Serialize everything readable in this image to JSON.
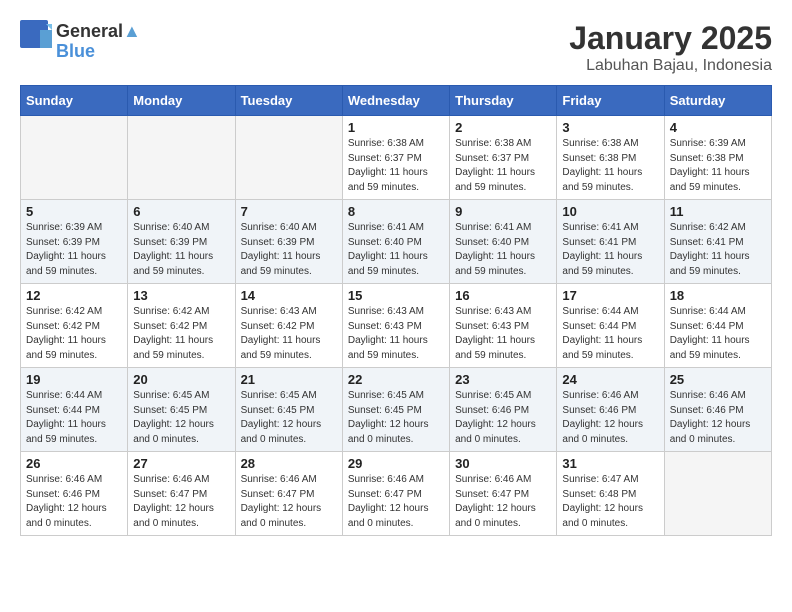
{
  "logo": {
    "general": "General",
    "blue": "Blue"
  },
  "title": "January 2025",
  "location": "Labuhan Bajau, Indonesia",
  "days_of_week": [
    "Sunday",
    "Monday",
    "Tuesday",
    "Wednesday",
    "Thursday",
    "Friday",
    "Saturday"
  ],
  "weeks": [
    [
      {
        "day": "",
        "info": ""
      },
      {
        "day": "",
        "info": ""
      },
      {
        "day": "",
        "info": ""
      },
      {
        "day": "1",
        "info": "Sunrise: 6:38 AM\nSunset: 6:37 PM\nDaylight: 11 hours\nand 59 minutes."
      },
      {
        "day": "2",
        "info": "Sunrise: 6:38 AM\nSunset: 6:37 PM\nDaylight: 11 hours\nand 59 minutes."
      },
      {
        "day": "3",
        "info": "Sunrise: 6:38 AM\nSunset: 6:38 PM\nDaylight: 11 hours\nand 59 minutes."
      },
      {
        "day": "4",
        "info": "Sunrise: 6:39 AM\nSunset: 6:38 PM\nDaylight: 11 hours\nand 59 minutes."
      }
    ],
    [
      {
        "day": "5",
        "info": "Sunrise: 6:39 AM\nSunset: 6:39 PM\nDaylight: 11 hours\nand 59 minutes."
      },
      {
        "day": "6",
        "info": "Sunrise: 6:40 AM\nSunset: 6:39 PM\nDaylight: 11 hours\nand 59 minutes."
      },
      {
        "day": "7",
        "info": "Sunrise: 6:40 AM\nSunset: 6:39 PM\nDaylight: 11 hours\nand 59 minutes."
      },
      {
        "day": "8",
        "info": "Sunrise: 6:41 AM\nSunset: 6:40 PM\nDaylight: 11 hours\nand 59 minutes."
      },
      {
        "day": "9",
        "info": "Sunrise: 6:41 AM\nSunset: 6:40 PM\nDaylight: 11 hours\nand 59 minutes."
      },
      {
        "day": "10",
        "info": "Sunrise: 6:41 AM\nSunset: 6:41 PM\nDaylight: 11 hours\nand 59 minutes."
      },
      {
        "day": "11",
        "info": "Sunrise: 6:42 AM\nSunset: 6:41 PM\nDaylight: 11 hours\nand 59 minutes."
      }
    ],
    [
      {
        "day": "12",
        "info": "Sunrise: 6:42 AM\nSunset: 6:42 PM\nDaylight: 11 hours\nand 59 minutes."
      },
      {
        "day": "13",
        "info": "Sunrise: 6:42 AM\nSunset: 6:42 PM\nDaylight: 11 hours\nand 59 minutes."
      },
      {
        "day": "14",
        "info": "Sunrise: 6:43 AM\nSunset: 6:42 PM\nDaylight: 11 hours\nand 59 minutes."
      },
      {
        "day": "15",
        "info": "Sunrise: 6:43 AM\nSunset: 6:43 PM\nDaylight: 11 hours\nand 59 minutes."
      },
      {
        "day": "16",
        "info": "Sunrise: 6:43 AM\nSunset: 6:43 PM\nDaylight: 11 hours\nand 59 minutes."
      },
      {
        "day": "17",
        "info": "Sunrise: 6:44 AM\nSunset: 6:44 PM\nDaylight: 11 hours\nand 59 minutes."
      },
      {
        "day": "18",
        "info": "Sunrise: 6:44 AM\nSunset: 6:44 PM\nDaylight: 11 hours\nand 59 minutes."
      }
    ],
    [
      {
        "day": "19",
        "info": "Sunrise: 6:44 AM\nSunset: 6:44 PM\nDaylight: 11 hours\nand 59 minutes."
      },
      {
        "day": "20",
        "info": "Sunrise: 6:45 AM\nSunset: 6:45 PM\nDaylight: 12 hours\nand 0 minutes."
      },
      {
        "day": "21",
        "info": "Sunrise: 6:45 AM\nSunset: 6:45 PM\nDaylight: 12 hours\nand 0 minutes."
      },
      {
        "day": "22",
        "info": "Sunrise: 6:45 AM\nSunset: 6:45 PM\nDaylight: 12 hours\nand 0 minutes."
      },
      {
        "day": "23",
        "info": "Sunrise: 6:45 AM\nSunset: 6:46 PM\nDaylight: 12 hours\nand 0 minutes."
      },
      {
        "day": "24",
        "info": "Sunrise: 6:46 AM\nSunset: 6:46 PM\nDaylight: 12 hours\nand 0 minutes."
      },
      {
        "day": "25",
        "info": "Sunrise: 6:46 AM\nSunset: 6:46 PM\nDaylight: 12 hours\nand 0 minutes."
      }
    ],
    [
      {
        "day": "26",
        "info": "Sunrise: 6:46 AM\nSunset: 6:46 PM\nDaylight: 12 hours\nand 0 minutes."
      },
      {
        "day": "27",
        "info": "Sunrise: 6:46 AM\nSunset: 6:47 PM\nDaylight: 12 hours\nand 0 minutes."
      },
      {
        "day": "28",
        "info": "Sunrise: 6:46 AM\nSunset: 6:47 PM\nDaylight: 12 hours\nand 0 minutes."
      },
      {
        "day": "29",
        "info": "Sunrise: 6:46 AM\nSunset: 6:47 PM\nDaylight: 12 hours\nand 0 minutes."
      },
      {
        "day": "30",
        "info": "Sunrise: 6:46 AM\nSunset: 6:47 PM\nDaylight: 12 hours\nand 0 minutes."
      },
      {
        "day": "31",
        "info": "Sunrise: 6:47 AM\nSunset: 6:48 PM\nDaylight: 12 hours\nand 0 minutes."
      },
      {
        "day": "",
        "info": ""
      }
    ]
  ]
}
